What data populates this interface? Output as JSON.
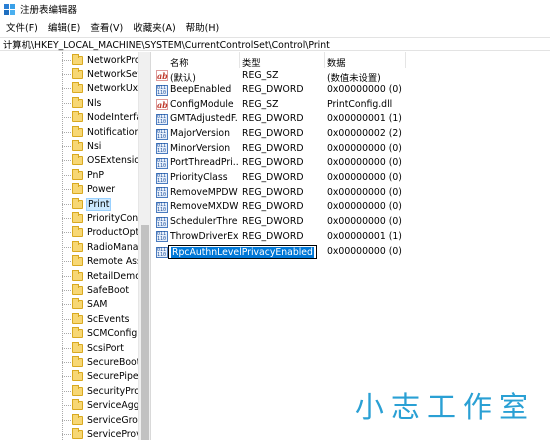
{
  "window": {
    "title": "注册表编辑器"
  },
  "menu": [
    "文件(F)",
    "编辑(E)",
    "查看(V)",
    "收藏夹(A)",
    "帮助(H)"
  ],
  "address": "计算机\\HKEY_LOCAL_MACHINE\\SYSTEM\\CurrentControlSet\\Control\\Print",
  "tree": {
    "items": [
      "NetworkProv",
      "NetworkSetu",
      "NetworkUxM",
      "Nls",
      "NodeInterfac",
      "Notifications",
      "Nsi",
      "OSExtensionI",
      "PnP",
      "Power",
      "Print",
      "PriorityContro",
      "ProductOptio",
      "RadioManag",
      "Remote Assis",
      "RetailDemo",
      "SafeBoot",
      "SAM",
      "ScEvents",
      "SCMConfig",
      "ScsiPort",
      "SecureBoot",
      "SecurePipeSe",
      "SecurityProvi",
      "ServiceAggre",
      "ServiceGroup",
      "ServiceProvic"
    ],
    "selected": "Print"
  },
  "list": {
    "headers": {
      "name": "名称",
      "type": "类型",
      "data": "数据"
    },
    "rows": [
      {
        "name": "(默认)",
        "type": "REG_SZ",
        "data": "(数值未设置)",
        "icon": "string-value-icon"
      },
      {
        "name": "BeepEnabled",
        "type": "REG_DWORD",
        "data": "0x00000000 (0)",
        "icon": "dword-value-icon"
      },
      {
        "name": "ConfigModule",
        "type": "REG_SZ",
        "data": "PrintConfig.dll",
        "icon": "string-value-icon"
      },
      {
        "name": "GMTAdjustedF...",
        "type": "REG_DWORD",
        "data": "0x00000001 (1)",
        "icon": "dword-value-icon"
      },
      {
        "name": "MajorVersion",
        "type": "REG_DWORD",
        "data": "0x00000002 (2)",
        "icon": "dword-value-icon"
      },
      {
        "name": "MinorVersion",
        "type": "REG_DWORD",
        "data": "0x00000000 (0)",
        "icon": "dword-value-icon"
      },
      {
        "name": "PortThreadPri...",
        "type": "REG_DWORD",
        "data": "0x00000000 (0)",
        "icon": "dword-value-icon"
      },
      {
        "name": "PriorityClass",
        "type": "REG_DWORD",
        "data": "0x00000000 (0)",
        "icon": "dword-value-icon"
      },
      {
        "name": "RemoveMPDW",
        "type": "REG_DWORD",
        "data": "0x00000000 (0)",
        "icon": "dword-value-icon"
      },
      {
        "name": "RemoveMXDW",
        "type": "REG_DWORD",
        "data": "0x00000000 (0)",
        "icon": "dword-value-icon"
      },
      {
        "name": "SchedulerThre...",
        "type": "REG_DWORD",
        "data": "0x00000000 (0)",
        "icon": "dword-value-icon"
      },
      {
        "name": "ThrowDriverEx...",
        "type": "REG_DWORD",
        "data": "0x00000001 (1)",
        "icon": "dword-value-icon"
      }
    ],
    "editing_row": {
      "name": "RpcAuthnLevelPrivacyEnabled",
      "type": "",
      "data": "0x00000000 (0)",
      "icon": "dword-value-icon"
    }
  },
  "watermark": "小志工作室",
  "colors": {
    "selection": "#0078d7",
    "tree_selected": "#cce8ff",
    "watermark": "#2aa0d4",
    "folder": "#f7d774"
  }
}
